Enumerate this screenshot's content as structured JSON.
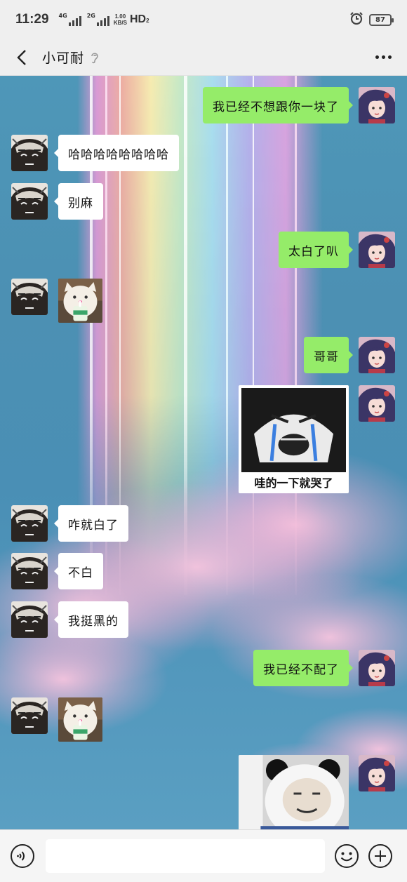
{
  "status_bar": {
    "time": "11:29",
    "net1_tag": "4G",
    "net2_tag": "2G",
    "speed_value": "1.00",
    "speed_unit": "KB/S",
    "hd_label": "HD",
    "hd_sub": "2",
    "battery": "87",
    "alarm_icon": "alarm-clock-icon"
  },
  "nav": {
    "back_icon": "chevron-left-icon",
    "title": "小可耐",
    "mute_icon": "ear-icon",
    "more_icon": "more-dots-icon"
  },
  "messages": [
    {
      "side": "out",
      "type": "text",
      "text": "我已经不想跟你一块了"
    },
    {
      "side": "in",
      "type": "text",
      "text": "哈哈哈哈哈哈哈哈"
    },
    {
      "side": "in",
      "type": "text",
      "text": "别麻"
    },
    {
      "side": "out",
      "type": "text",
      "text": "太白了叭"
    },
    {
      "side": "in",
      "type": "sticker",
      "sticker": "cat-drinking-sticker"
    },
    {
      "side": "out",
      "type": "text",
      "text": "哥哥"
    },
    {
      "side": "out",
      "type": "sticker",
      "sticker": "crying-face-sticker",
      "caption": "哇的一下就哭了"
    },
    {
      "side": "in",
      "type": "text",
      "text": "咋就白了"
    },
    {
      "side": "in",
      "type": "text",
      "text": "不白"
    },
    {
      "side": "in",
      "type": "text",
      "text": "我挺黑的"
    },
    {
      "side": "out",
      "type": "text",
      "text": "我已经不配了"
    },
    {
      "side": "in",
      "type": "sticker",
      "sticker": "cat-drinking-sticker"
    },
    {
      "side": "out",
      "type": "sticker",
      "sticker": "panda-face-sticker"
    }
  ],
  "input_bar": {
    "voice_icon": "voice-input-icon",
    "text_value": "",
    "emoji_icon": "emoji-icon",
    "plus_icon": "plus-icon"
  },
  "colors": {
    "outgoing_bubble": "#95ec69",
    "incoming_bubble": "#ffffff",
    "bar_background": "#efefef"
  }
}
